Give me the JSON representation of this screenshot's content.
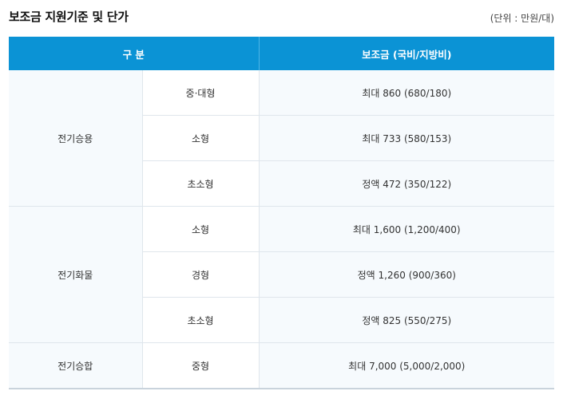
{
  "title": "보조금 지원기준 및 단가",
  "unit": "(단위 : 만원/대)",
  "header": {
    "category": "구 분",
    "amount": "보조금 (국비/지방비)"
  },
  "groups": [
    {
      "name": "전기승용",
      "rows": [
        {
          "type": "중·대형",
          "amount": "최대 860 (680/180)"
        },
        {
          "type": "소형",
          "amount": "최대 733 (580/153)"
        },
        {
          "type": "초소형",
          "amount": "정액 472 (350/122)"
        }
      ]
    },
    {
      "name": "전기화물",
      "rows": [
        {
          "type": "소형",
          "amount": "최대 1,600 (1,200/400)"
        },
        {
          "type": "경형",
          "amount": "정액 1,260 (900/360)"
        },
        {
          "type": "초소형",
          "amount": "정액 825 (550/275)"
        }
      ]
    },
    {
      "name": "전기승합",
      "rows": [
        {
          "type": "중형",
          "amount": "최대 7,000 (5,000/2,000)"
        }
      ]
    }
  ]
}
